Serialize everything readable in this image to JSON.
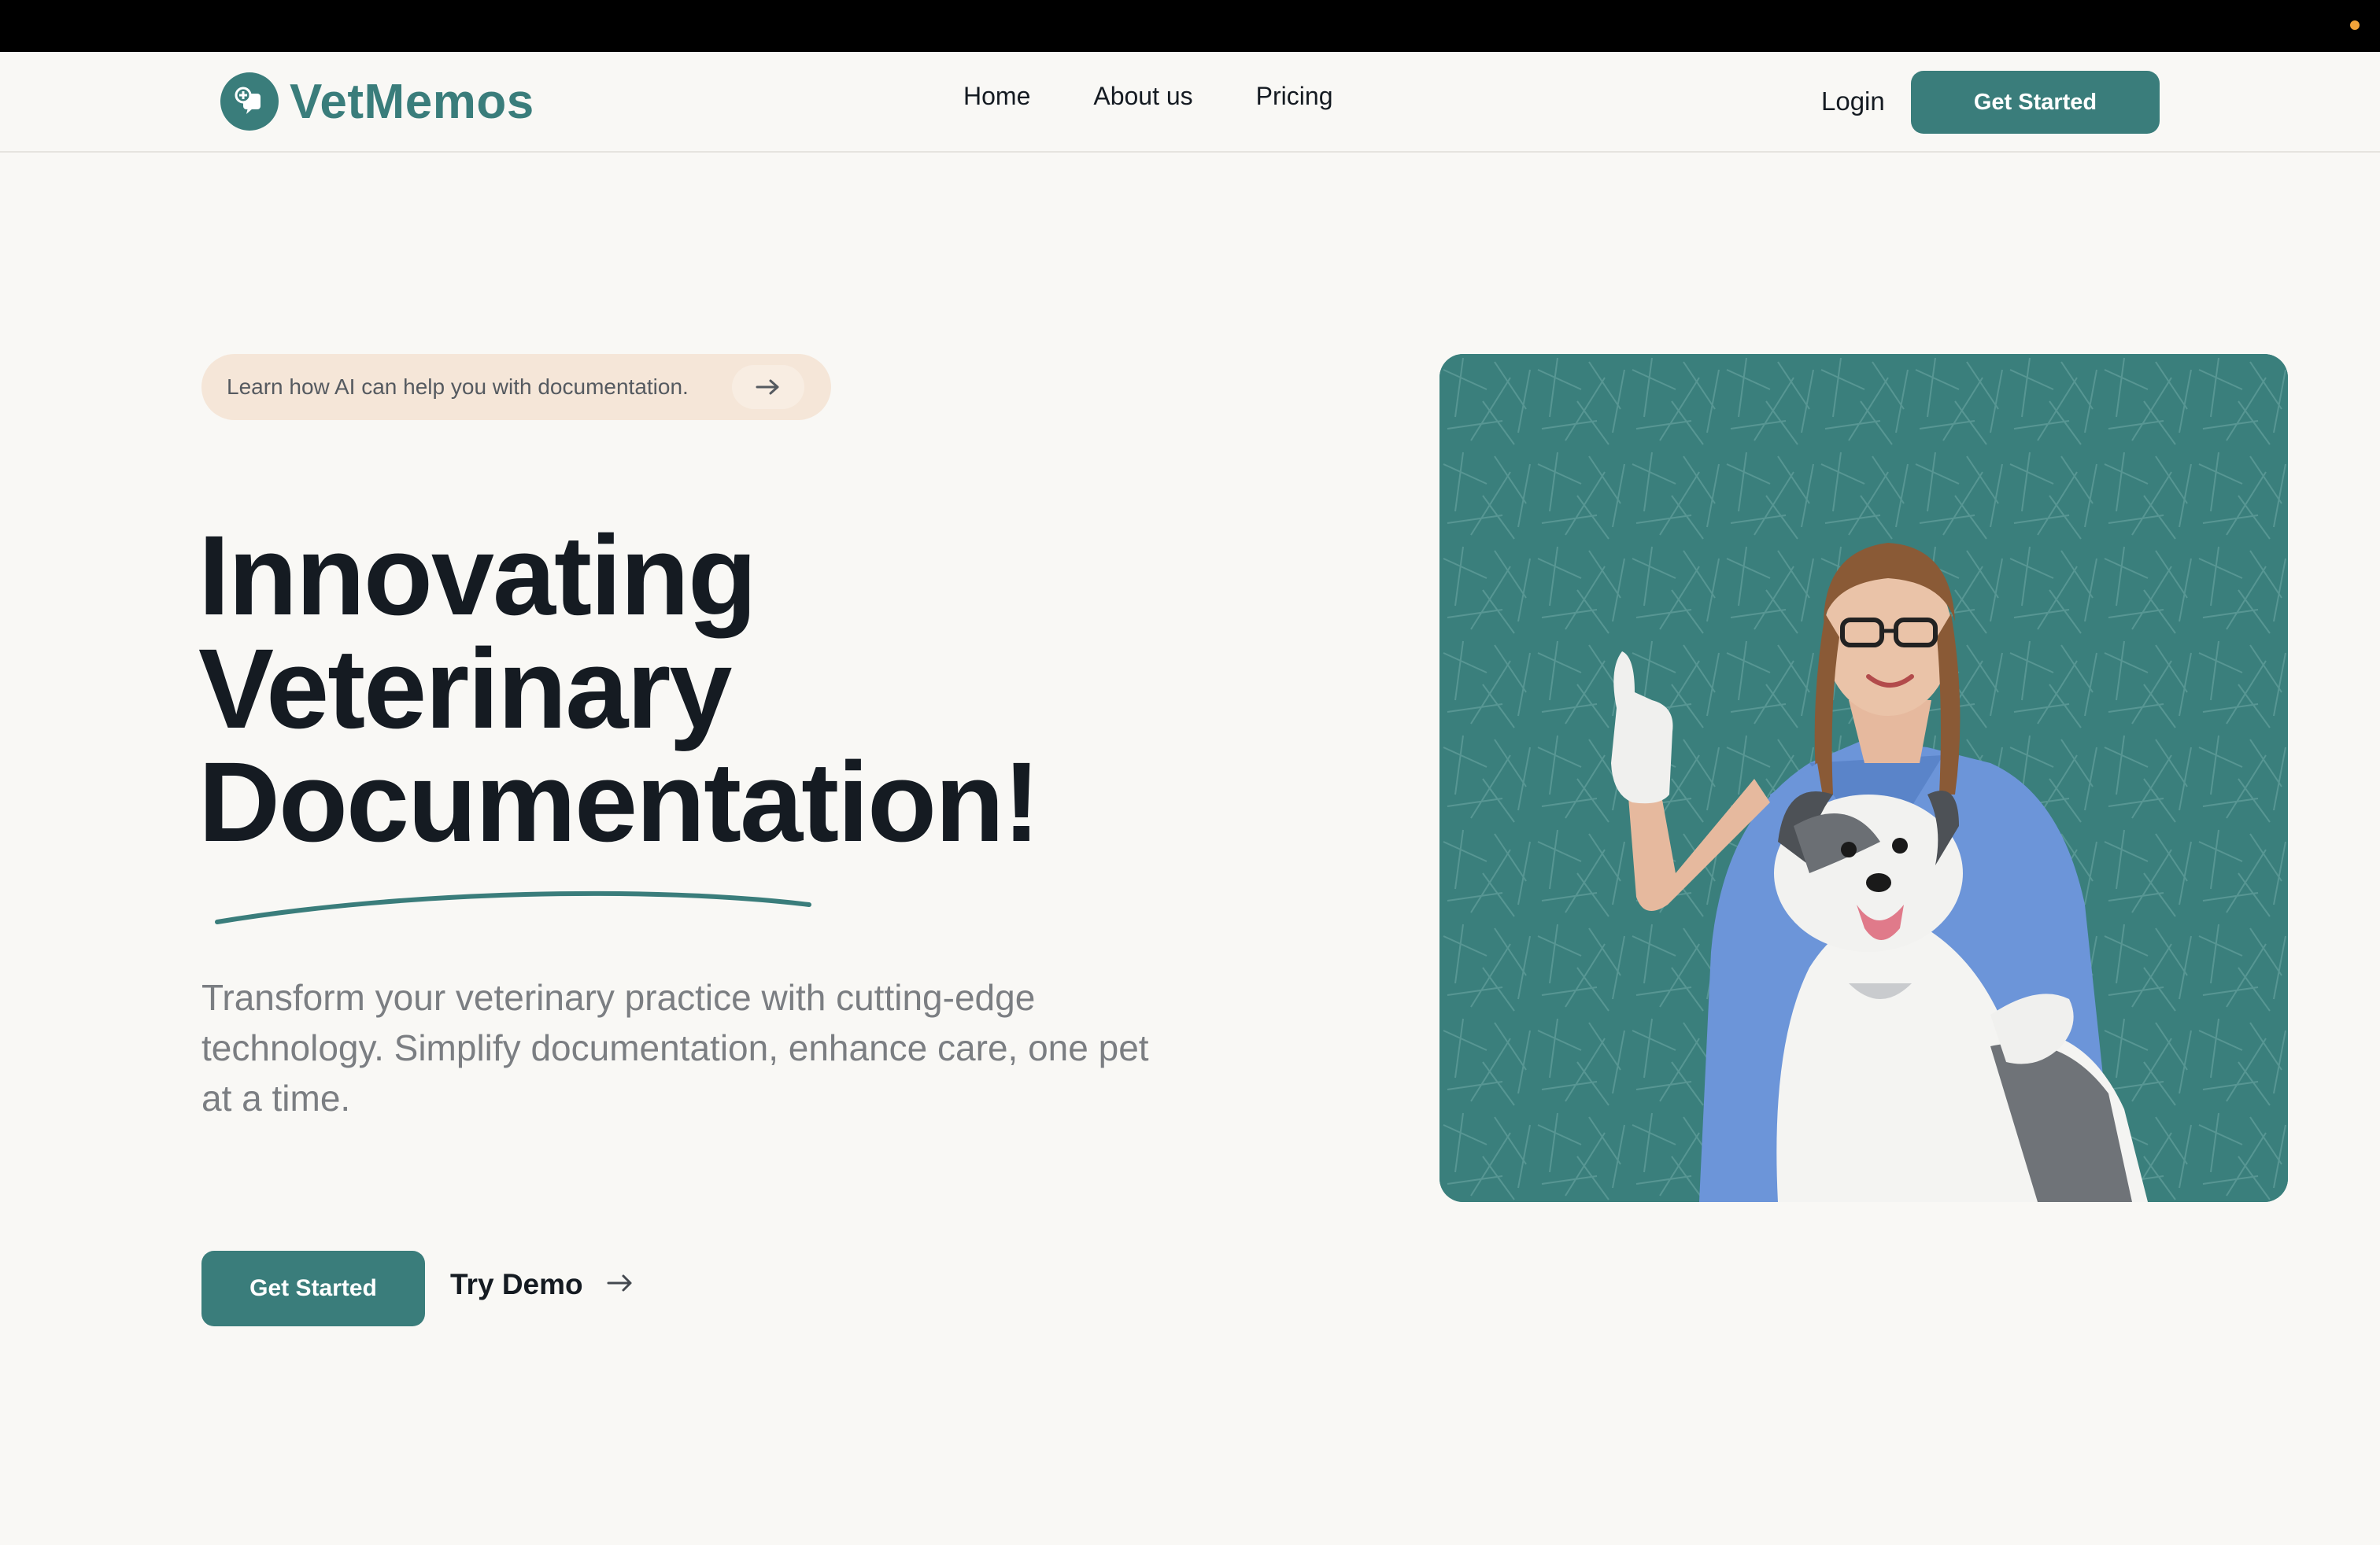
{
  "brand": {
    "name": "VetMemos",
    "icon": "chat-plus-icon",
    "color": "#3a7d7b"
  },
  "nav": {
    "links": [
      {
        "label": "Home"
      },
      {
        "label": "About us"
      },
      {
        "label": "Pricing"
      }
    ],
    "login_label": "Login",
    "cta_label": "Get Started"
  },
  "announcement": {
    "text": "Learn how AI can help you with documentation.",
    "icon": "arrow-right-icon"
  },
  "hero": {
    "headline_lines": [
      "Innovating",
      "Veterinary",
      "Documentation!"
    ],
    "subtext": "Transform your veterinary practice with cutting-edge technology. Simplify documentation, enhance care, one pet at a time.",
    "primary_cta": "Get Started",
    "secondary_cta": "Try Demo",
    "secondary_icon": "arrow-right-icon",
    "image": "veterinarian with dog photo"
  },
  "colors": {
    "accent": "#3a7d7b",
    "background": "#f9f8f5",
    "pill_background": "#f5e6d8",
    "status_dot": "#f1a33a"
  }
}
